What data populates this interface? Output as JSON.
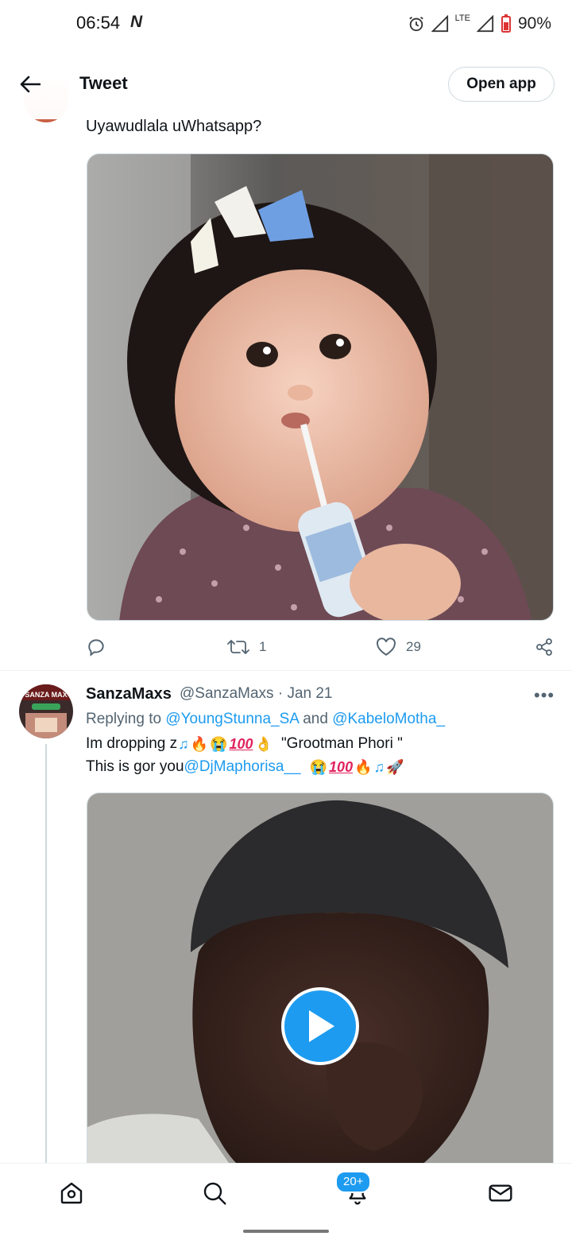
{
  "status_bar": {
    "time": "06:54",
    "network": "LTE",
    "battery": "90%"
  },
  "header": {
    "title": "Tweet",
    "open_app": "Open app"
  },
  "tweet1": {
    "text": "Uyawudlala uWhatsapp?",
    "retweets": "1",
    "likes": "29"
  },
  "tweet2": {
    "name": "SanzaMaxs",
    "handle": "@SanzaMaxs · Jan 21",
    "more": "•••",
    "replying_prefix": "Replying to ",
    "reply_user1": "@YoungStunna_SA",
    "reply_and": " and ",
    "reply_user2": "@KabeloMotha_",
    "line1_start": "Im dropping z",
    "line1_quote": "\"Grootman Phori \"",
    "line2_start": "This is gor you ",
    "line2_mention": "@DjMaphorisa__",
    "avatar_text": "SANZA MAX"
  },
  "nav": {
    "notif_badge": "20+"
  },
  "colors": {
    "accent": "#1d9bf0",
    "text": "#0f1419",
    "muted": "#536471"
  }
}
